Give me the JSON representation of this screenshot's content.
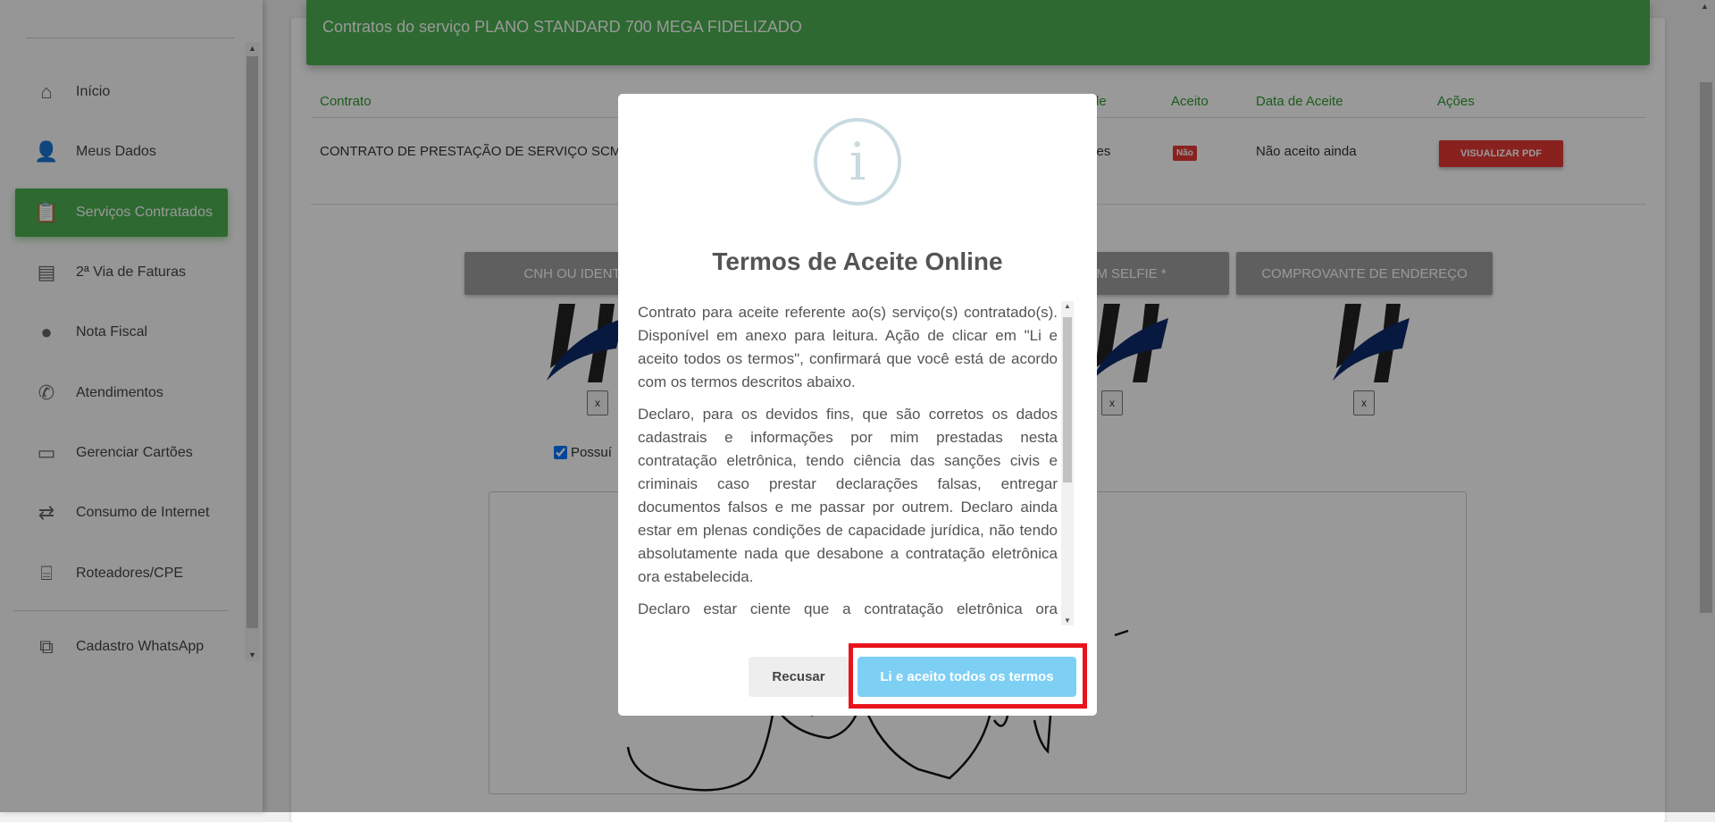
{
  "sidebar": {
    "items": [
      {
        "label": "Início",
        "icon": "home-icon"
      },
      {
        "label": "Meus Dados",
        "icon": "person-icon"
      },
      {
        "label": "Serviços Contratados",
        "icon": "clipboard-icon",
        "active": true
      },
      {
        "label": "2ª Via de Faturas",
        "icon": "receipt-icon"
      },
      {
        "label": "Nota Fiscal",
        "icon": "bubbles-icon"
      },
      {
        "label": "Atendimentos",
        "icon": "phone-icon"
      },
      {
        "label": "Gerenciar Cartões",
        "icon": "credit-card-icon"
      },
      {
        "label": "Consumo de Internet",
        "icon": "transfer-arrows-icon"
      },
      {
        "label": "Roteadores/CPE",
        "icon": "router-icon"
      },
      {
        "label": "Cadastro WhatsApp",
        "icon": "external-link-icon"
      }
    ]
  },
  "header": {
    "title": "Contratos do serviço PLANO STANDARD 700 MEGA FIDELIZADO"
  },
  "table": {
    "columns": [
      "Contrato",
      "de",
      "Aceito",
      "Data de Aceite",
      "Ações"
    ],
    "rows": [
      {
        "contrato": "CONTRATO DE PRESTAÇÃO DE SERVIÇO SCM",
        "partial": "ses",
        "aceito": "Não",
        "data_aceite": "Não aceito ainda",
        "action": "VISUALIZAR PDF"
      }
    ]
  },
  "documents": {
    "buttons": [
      "CNH OU IDENTIDADE",
      "",
      "FOTO COM SELFIE *",
      "COMPROVANTE DE ENDEREÇO"
    ],
    "remove_label": "x",
    "checkbox_label": "Possuí",
    "checkbox_checked": true
  },
  "modal": {
    "icon": "info-icon",
    "icon_glyph": "i",
    "title": "Termos de Aceite Online",
    "paragraphs": [
      "Contrato para aceite referente ao(s) serviço(s) contratado(s). Disponível em anexo para leitura. Ação de clicar em \"Li e aceito todos os termos\", confirmará que você está de acordo com os termos descritos abaixo.",
      "Declaro, para os devidos fins, que são corretos os dados cadastrais e informações por mim prestadas nesta contratação eletrônica, tendo ciência das sanções civis e criminais caso prestar declarações falsas, entregar documentos falsos e me passar por outrem. Declaro ainda estar em plenas condições de capacidade jurídica, não tendo absolutamente nada que desabone a contratação eletrônica ora estabelecida.",
      "Declaro estar ciente que a contratação eletrônica ora estabelecida representa expressa concordância aos termos e condições do(s) contrato(s) exibidos aqui nesse"
    ],
    "decline_label": "Recusar",
    "accept_label": "Li e aceito todos os termos"
  },
  "colors": {
    "accent": "#4caf50",
    "danger": "#e53935",
    "accept": "#7ecff4",
    "highlight": "#e8141c"
  }
}
